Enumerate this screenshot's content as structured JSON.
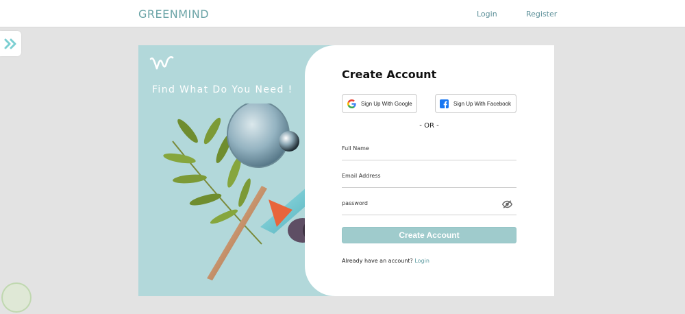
{
  "header": {
    "brand": "GREENMIND",
    "nav": {
      "login_label": "Login",
      "register_label": "Register"
    }
  },
  "hero": {
    "tagline": "Find What Do You Need !"
  },
  "form": {
    "title": "Create Account",
    "google_label": "Sign Up With Google",
    "facebook_label": "Sign Up With Facebook",
    "divider": "- OR -",
    "full_name": {
      "value": "",
      "placeholder": "Full Name"
    },
    "email": {
      "value": "",
      "placeholder": "Email Address"
    },
    "password": {
      "value": "",
      "placeholder": "password"
    },
    "submit_label": "Create Account",
    "signin_prompt": "Already have an account?",
    "signin_link": "Login"
  },
  "icons": {
    "sidebar_toggle": "double-chevron-right-icon",
    "password_toggle": "eye-off-icon",
    "google": "google-icon",
    "facebook": "facebook-icon"
  },
  "colors": {
    "brand": "#6aa3a6",
    "hero_bg": "#b2d8da",
    "button_bg": "#9fcbcc",
    "link": "#5b9aa0",
    "page_bg": "#e3e3e3"
  }
}
